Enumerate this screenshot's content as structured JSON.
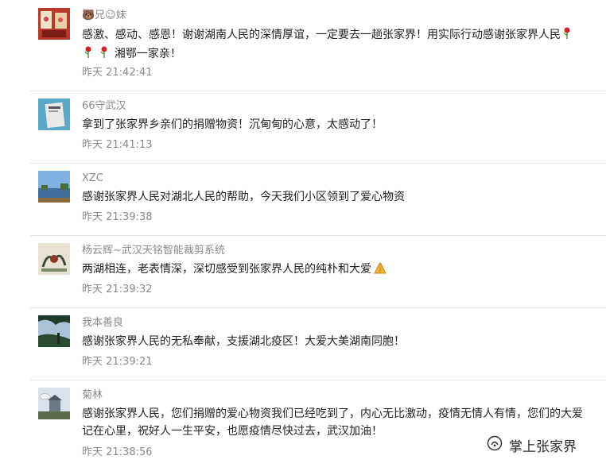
{
  "comments": [
    {
      "nickname": "🐻兄☺妹",
      "content_line1": "感激、感动、感恩！谢谢湖南人民的深情厚谊，一定要去一趟张家界！用实际行动感谢张家界人民",
      "content_line2": "湘鄂一家亲！",
      "time": "昨天 21:42:41",
      "emoji": "rose-icon"
    },
    {
      "nickname": "66守武汉",
      "content": "拿到了张家界乡亲们的捐赠物资！沉甸甸的心意，太感动了！",
      "time": "昨天 21:41:13"
    },
    {
      "nickname": "XZC",
      "content": "感谢张家界人民对湖北人民的帮助，今天我们小区领到了爱心物资",
      "time": "昨天 21:39:38"
    },
    {
      "nickname": "杨云辉~武汉天铭智能裁剪系统",
      "content": "两湖相连，老表情深，深切感受到张家界人民的纯朴和大爱",
      "time": "昨天 21:39:32",
      "emoji": "praying-hands-icon"
    },
    {
      "nickname": "我本善良",
      "content": "感谢张家界人民的无私奉献，支援湖北疫区！大爱大美湖南同胞！",
      "time": "昨天 21:39:21"
    },
    {
      "nickname": "菊林",
      "content": "感谢张家界人民，您们捐赠的爱心物资我们已经吃到了，内心无比激动，疫情无情人有情，您们的大爱记在心里，祝好人一生平安，也愿疫情尽快过去，武汉加油！",
      "time": "昨天 21:38:56"
    }
  ],
  "watermark": {
    "text": "掌上张家界",
    "icon": "wechat-official-account-icon"
  }
}
